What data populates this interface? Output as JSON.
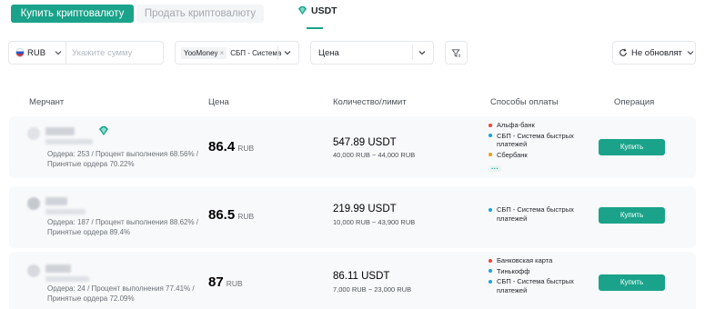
{
  "tabs": {
    "buy": "Купить криптовалюту",
    "sell": "Продать криптовалюту",
    "asset": "USDT"
  },
  "filters": {
    "currency": "RUB",
    "amount_placeholder": "Укажите сумму",
    "payment_chip1": "YooMoney",
    "payment_chip2": "СБП - Система",
    "sort": "Цена",
    "refresh": "Не обновлят"
  },
  "columns": {
    "merchant": "Мерчант",
    "price": "Цена",
    "qty": "Количество/лимит",
    "methods": "Способы оплаты",
    "action": "Операция"
  },
  "colors": {
    "accent": "#1aa38a",
    "red": "#f0443a",
    "blue": "#16a3e0",
    "orange": "#f39a1a"
  },
  "rows": [
    {
      "stats1": "Ордера: 253 / Процент выполнения 68.56% /",
      "stats2": "Принятые ордера 70.22%",
      "price": "86.4",
      "unit": "RUB",
      "qty": "547.89 USDT",
      "limit": "40,000 RUB ~ 44,000 RUB",
      "methods": [
        "Альфа-банк",
        "СБП - Система быстрых платежей",
        "Сбербанк"
      ],
      "more": "···",
      "buy": "Купить"
    },
    {
      "stats1": "Ордера: 187 / Процент выполнения 88.62% /",
      "stats2": "Принятые ордера 89.4%",
      "price": "86.5",
      "unit": "RUB",
      "qty": "219.99 USDT",
      "limit": "10,000 RUB ~ 43,900 RUB",
      "methods": [
        "СБП - Система быстрых платежей"
      ],
      "buy": "Купить"
    },
    {
      "stats1": "Ордера: 24 / Процент выполнения 77.41% /",
      "stats2": "Принятые ордера 72.09%",
      "price": "87",
      "unit": "RUB",
      "qty": "86.11 USDT",
      "limit": "7,000 RUB ~ 23,000 RUB",
      "methods": [
        "Банковская карта",
        "Тинькофф",
        "СБП - Система быстрых платежей"
      ],
      "buy": "Купить"
    }
  ]
}
